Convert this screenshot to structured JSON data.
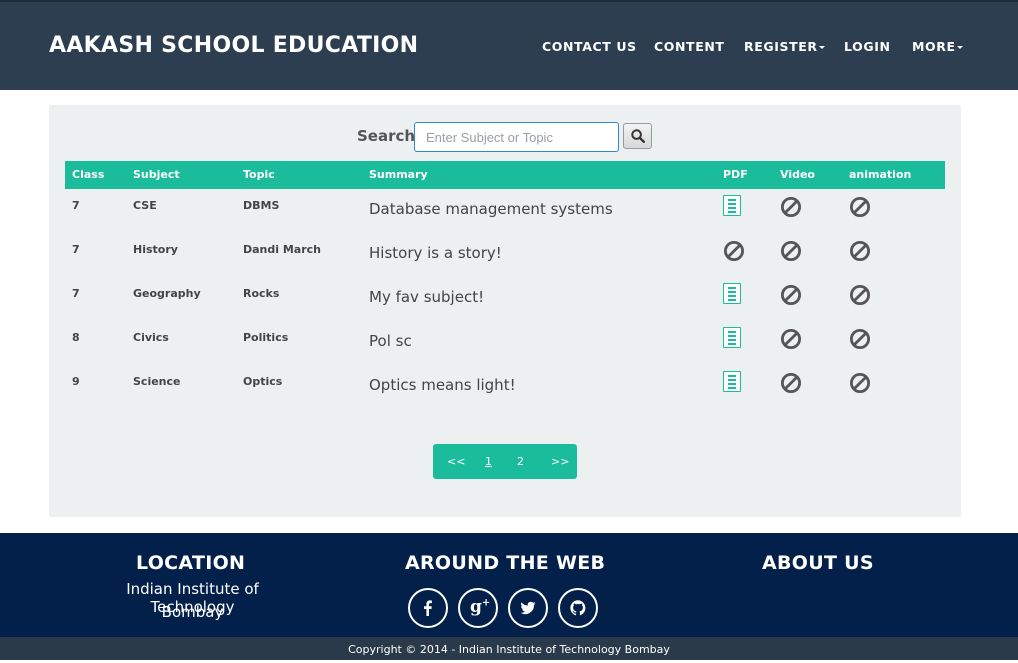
{
  "header": {
    "brand": "AAKASH SCHOOL EDUCATION",
    "nav": [
      "CONTACT US",
      "CONTENT",
      "REGISTER",
      "LOGIN",
      "MORE"
    ]
  },
  "search": {
    "label": "Search:",
    "placeholder": "Enter Subject or Topic",
    "value": ""
  },
  "table": {
    "columns": [
      "Class",
      "Subject",
      "Topic",
      "Summary",
      "PDF",
      "Video",
      "animation"
    ],
    "rows": [
      {
        "class": "7",
        "subject": "CSE",
        "topic": "DBMS",
        "summary": "Database management systems",
        "pdf": "pdf-file-icon",
        "video": "unavailable-icon",
        "animation": "unavailable-icon"
      },
      {
        "class": "7",
        "subject": "History",
        "topic": "Dandi March",
        "summary": "History is a story!",
        "pdf": "unavailable-icon",
        "video": "unavailable-icon",
        "animation": "unavailable-icon"
      },
      {
        "class": "7",
        "subject": "Geography",
        "topic": "Rocks",
        "summary": "My fav subject!",
        "pdf": "pdf-file-icon",
        "video": "unavailable-icon",
        "animation": "unavailable-icon"
      },
      {
        "class": "8",
        "subject": "Civics",
        "topic": "Politics",
        "summary": "Pol sc",
        "pdf": "pdf-file-icon",
        "video": "unavailable-icon",
        "animation": "unavailable-icon"
      },
      {
        "class": "9",
        "subject": "Science",
        "topic": "Optics",
        "summary": "Optics means light!",
        "pdf": "pdf-file-icon",
        "video": "unavailable-icon",
        "animation": "unavailable-icon"
      }
    ]
  },
  "pagination": {
    "items": [
      "<<",
      "1",
      "2",
      ">>"
    ],
    "current": "1"
  },
  "footer": {
    "location_title": "LOCATION",
    "location_line1": "Indian Institute of Technology",
    "location_line2": "Bombay",
    "web_title": "AROUND THE WEB",
    "about_title": "ABOUT US",
    "social": [
      "facebook-icon",
      "google-plus-icon",
      "twitter-icon",
      "github-icon"
    ]
  },
  "copyright": "Copyright © 2014 - Indian Institute of Technology Bombay",
  "colors": {
    "navbar": "#2c3e50",
    "accent": "#1abc9c",
    "panel": "#ecf0f1",
    "footer": "#02204a"
  }
}
